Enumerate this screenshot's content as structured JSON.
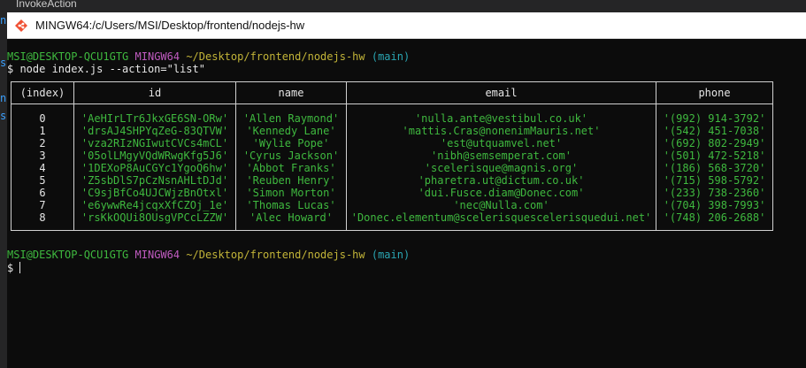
{
  "background": {
    "window_title": "InvokeAction",
    "left_glyphs": [
      "n",
      "s",
      "n",
      "s"
    ]
  },
  "window": {
    "title": "MINGW64:/c/Users/MSI/Desktop/frontend/nodejs-hw"
  },
  "prompt1": {
    "user_host": "MSI@DESKTOP-QCU1GTG",
    "shell": "MINGW64",
    "path": "~/Desktop/frontend/nodejs-hw",
    "branch": "(main)"
  },
  "command": "$ node index.js --action=\"list\"",
  "table": {
    "headers": [
      "(index)",
      "id",
      "name",
      "email",
      "phone"
    ],
    "rows": [
      {
        "index": "0",
        "id": "'AeHIrLTr6JkxGE6SN-ORw'",
        "name": "'Allen Raymond'",
        "email": "'nulla.ante@vestibul.co.uk'",
        "phone": "'(992) 914-3792'"
      },
      {
        "index": "1",
        "id": "'drsAJ4SHPYqZeG-83QTVW'",
        "name": "'Kennedy Lane'",
        "email": "'mattis.Cras@nonenimMauris.net'",
        "phone": "'(542) 451-7038'"
      },
      {
        "index": "2",
        "id": "'vza2RIzNGIwutCVCs4mCL'",
        "name": "'Wylie Pope'",
        "email": "'est@utquamvel.net'",
        "phone": "'(692) 802-2949'"
      },
      {
        "index": "3",
        "id": "'05olLMgyVQdWRwgKfg5J6'",
        "name": "'Cyrus Jackson'",
        "email": "'nibh@semsemperat.com'",
        "phone": "'(501) 472-5218'"
      },
      {
        "index": "4",
        "id": "'1DEXoP8AuCGYc1YgoQ6hw'",
        "name": "'Abbot Franks'",
        "email": "'scelerisque@magnis.org'",
        "phone": "'(186) 568-3720'"
      },
      {
        "index": "5",
        "id": "'Z5sbDlS7pCzNsnAHLtDJd'",
        "name": "'Reuben Henry'",
        "email": "'pharetra.ut@dictum.co.uk'",
        "phone": "'(715) 598-5792'"
      },
      {
        "index": "6",
        "id": "'C9sjBfCo4UJCWjzBnOtxl'",
        "name": "'Simon Morton'",
        "email": "'dui.Fusce.diam@Donec.com'",
        "phone": "'(233) 738-2360'"
      },
      {
        "index": "7",
        "id": "'e6ywwRe4jcqxXfCZOj_1e'",
        "name": "'Thomas Lucas'",
        "email": "'nec@Nulla.com'",
        "phone": "'(704) 398-7993'"
      },
      {
        "index": "8",
        "id": "'rsKkOQUi8OUsgVPCcLZZW'",
        "name": "'Alec Howard'",
        "email": "'Donec.elementum@scelerisquescelerisquedui.net'",
        "phone": "'(748) 206-2688'"
      }
    ]
  },
  "prompt2": {
    "user_host": "MSI@DESKTOP-QCU1GTG",
    "shell": "MINGW64",
    "path": "~/Desktop/frontend/nodejs-hw",
    "branch": "(main)"
  },
  "input_prompt": "$ "
}
